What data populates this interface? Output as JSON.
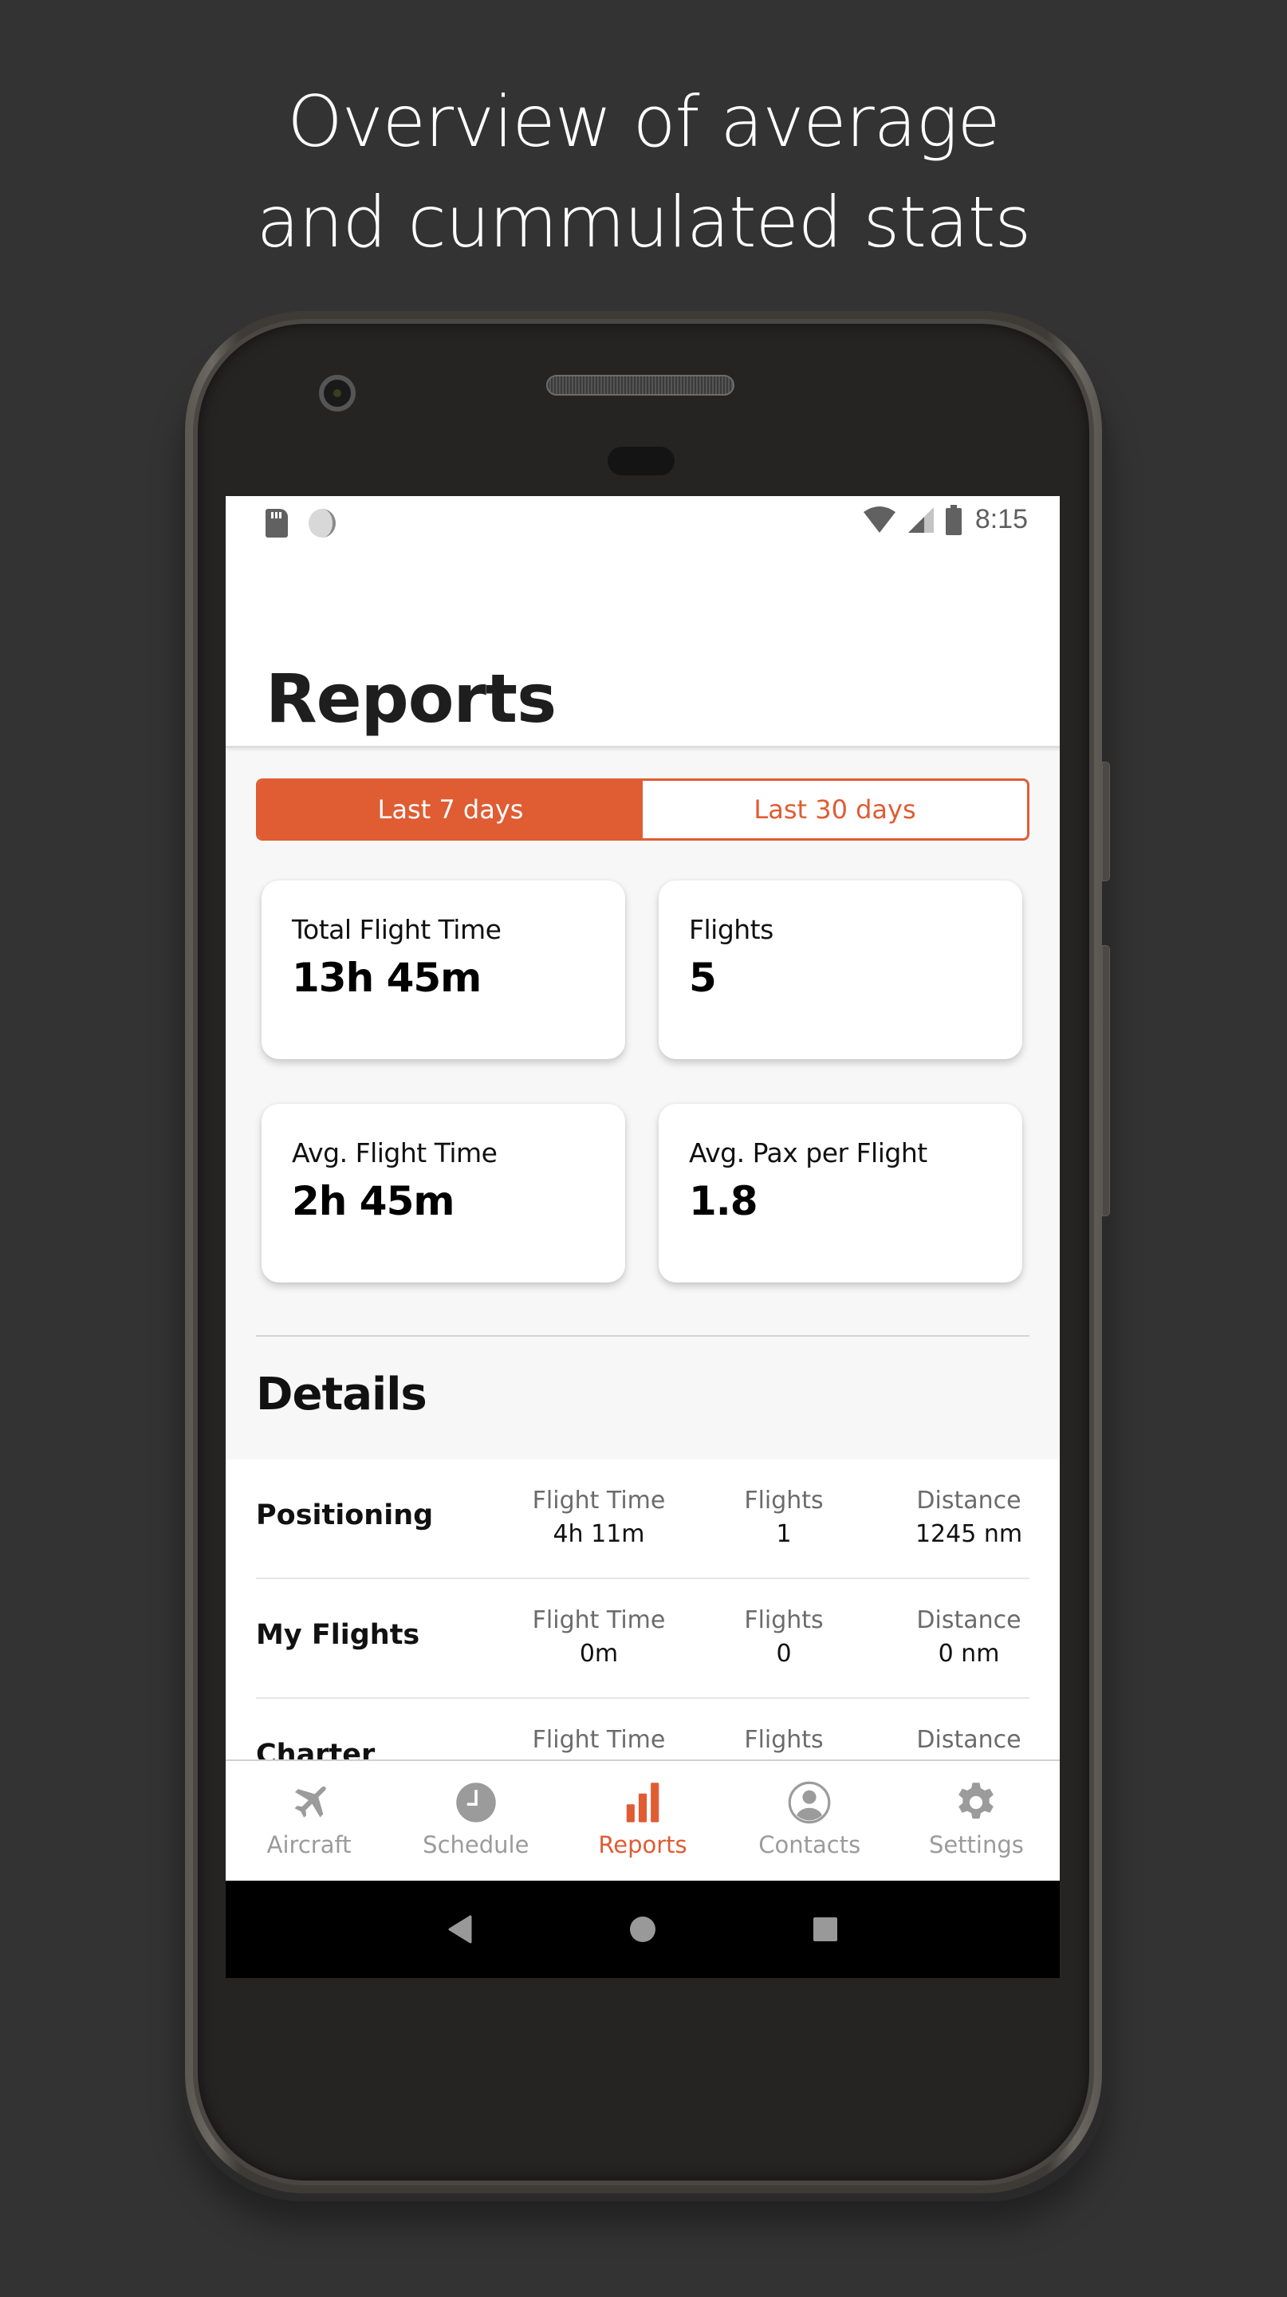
{
  "headline": {
    "line1": "Overview of average",
    "line2": "and cummulated stats"
  },
  "status_bar": {
    "left_icons": [
      "sd-card-icon",
      "sync-icon"
    ],
    "right_icons": [
      "wifi-icon",
      "cell-signal-icon",
      "battery-icon"
    ],
    "time": "8:15"
  },
  "header": {
    "title": "Reports"
  },
  "period_toggle": {
    "options": [
      {
        "label": "Last 7 days",
        "selected": true
      },
      {
        "label": "Last 30 days",
        "selected": false
      }
    ]
  },
  "summary_cards": [
    {
      "label": "Total Flight Time",
      "value": "13h 45m"
    },
    {
      "label": "Flights",
      "value": "5"
    },
    {
      "label": "Avg. Flight Time",
      "value": "2h 45m"
    },
    {
      "label": "Avg. Pax per Flight",
      "value": "1.8"
    }
  ],
  "details": {
    "title": "Details",
    "columns": [
      "Flight Time",
      "Flights",
      "Distance"
    ],
    "rows": [
      {
        "name": "Positioning",
        "flight_time": "4h 11m",
        "flights": "1",
        "distance": "1245 nm"
      },
      {
        "name": "My Flights",
        "flight_time": "0m",
        "flights": "0",
        "distance": "0 nm"
      },
      {
        "name": "Charter",
        "flight_time": "",
        "flights": "",
        "distance": ""
      }
    ]
  },
  "bottom_nav": {
    "items": [
      {
        "label": "Aircraft",
        "icon": "airplane-icon",
        "active": false
      },
      {
        "label": "Schedule",
        "icon": "clock-icon",
        "active": false
      },
      {
        "label": "Reports",
        "icon": "bar-chart-icon",
        "active": true
      },
      {
        "label": "Contacts",
        "icon": "person-circle-icon",
        "active": false
      },
      {
        "label": "Settings",
        "icon": "gear-icon",
        "active": false
      }
    ]
  },
  "system_nav": {
    "buttons": [
      "back-icon",
      "home-icon",
      "recents-icon"
    ]
  },
  "colors": {
    "accent": "#e05c33",
    "inactive": "#9b9b9b",
    "background": "#333333",
    "screen_bg": "#f7f7f7"
  }
}
